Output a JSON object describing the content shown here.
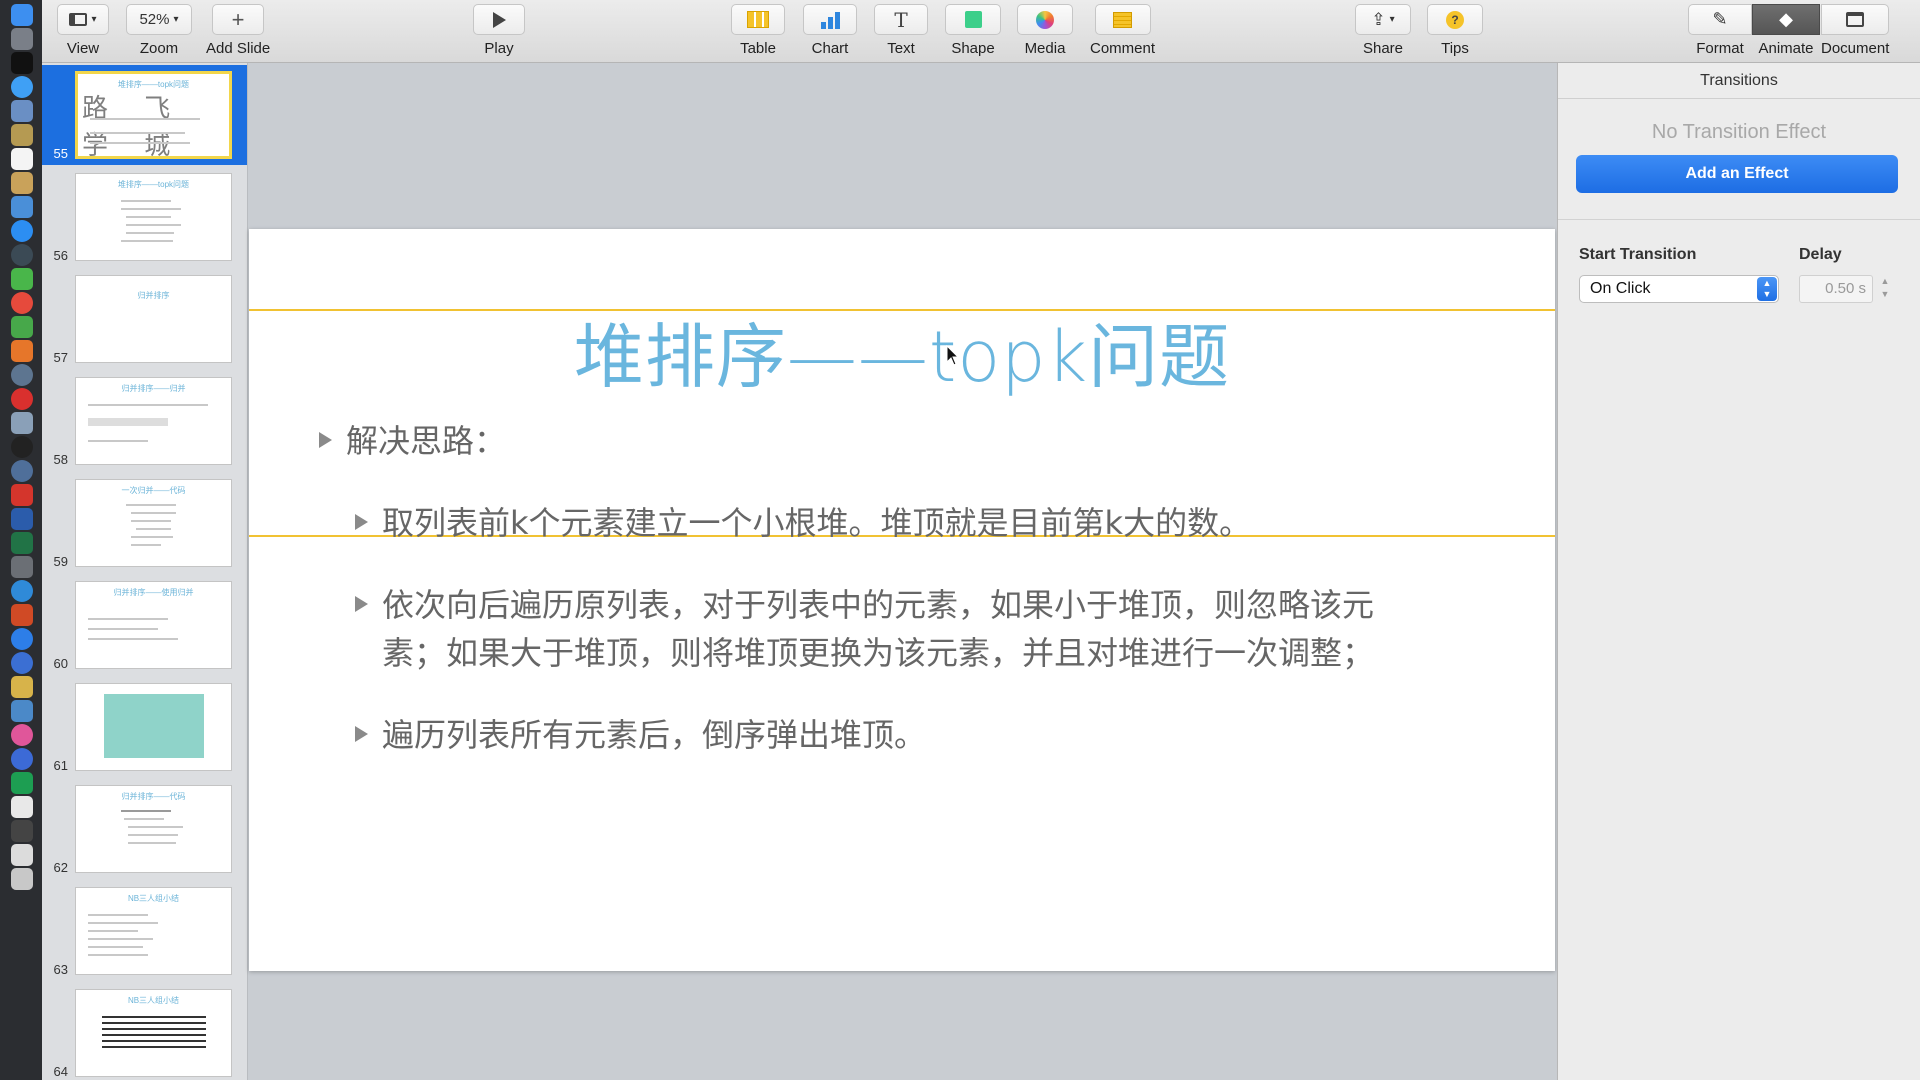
{
  "toolbar": {
    "view": "View",
    "zoom_value": "52%",
    "zoom": "Zoom",
    "add_slide": "Add Slide",
    "play": "Play",
    "table": "Table",
    "chart": "Chart",
    "text": "Text",
    "shape": "Shape",
    "media": "Media",
    "comment": "Comment",
    "share": "Share",
    "tips": "Tips",
    "format": "Format",
    "animate": "Animate",
    "document": "Document"
  },
  "navigator": {
    "slides": [
      {
        "num": "55",
        "title": "堆排序——topk问题",
        "watermark": "路 飞 学 城",
        "selected": true
      },
      {
        "num": "56",
        "title": "堆排序——topk问题"
      },
      {
        "num": "57",
        "title": "归并排序"
      },
      {
        "num": "58",
        "title": "归并排序——归并"
      },
      {
        "num": "59",
        "title": "一次归并——代码"
      },
      {
        "num": "60",
        "title": "归并排序——使用归并"
      },
      {
        "num": "61",
        "title": ""
      },
      {
        "num": "62",
        "title": "归并排序——代码"
      },
      {
        "num": "63",
        "title": "NB三人组小结"
      },
      {
        "num": "64",
        "title": "NB三人组小结"
      }
    ]
  },
  "slide": {
    "title": "堆排序——topk问题",
    "bullets": [
      "解决思路：",
      "取列表前k个元素建立一个小根堆。堆顶就是目前第k大的数。",
      "依次向后遍历原列表，对于列表中的元素，如果小于堆顶，则忽略该元",
      "素；如果大于堆顶，则将堆顶更换为该元素，并且对堆进行一次调整；",
      "遍历列表所有元素后，倒序弹出堆顶。"
    ]
  },
  "inspector": {
    "tab": "Transitions",
    "no_effect": "No Transition Effect",
    "add_effect": "Add an Effect",
    "start_label": "Start Transition",
    "start_value": "On Click",
    "delay_label": "Delay",
    "delay_value": "0.50 s"
  },
  "colors": {
    "accent": "#1d6de4",
    "title": "#6ab6de",
    "guide": "#f1c232"
  }
}
